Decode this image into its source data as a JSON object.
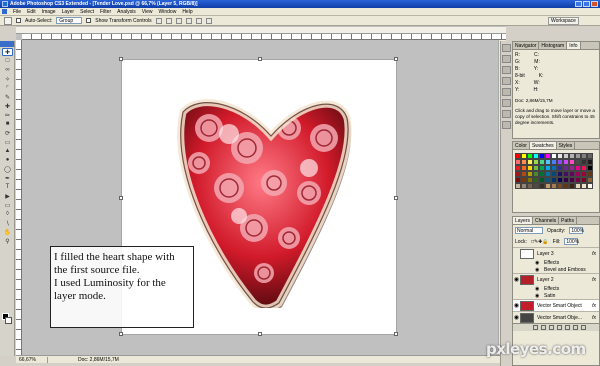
{
  "window": {
    "title": "Adobe Photoshop CS3 Extended - [Tender Love.psd @ 66,7% (Layer 5, RGB/8)]"
  },
  "menu": [
    "File",
    "Edit",
    "Image",
    "Layer",
    "Select",
    "Filter",
    "Analysis",
    "View",
    "Window",
    "Help"
  ],
  "options_bar": {
    "auto_select_label": "Auto-Select:",
    "auto_select_value": "Group",
    "show_transform_label": "Show Transform Controls",
    "workspace_label": "Workspace"
  },
  "status": {
    "zoom": "66,67%",
    "doc": "Doc: 2,86M/15,7M"
  },
  "navigator_panel": {
    "tabs": [
      "Navigator",
      "Histogram",
      "Info"
    ],
    "active_tab": "Info",
    "info_rows": [
      [
        "R:",
        "C:"
      ],
      [
        "G:",
        "M:"
      ],
      [
        "B:",
        "Y:"
      ],
      [
        "8-bit",
        "K:"
      ],
      [
        "X:",
        "W:"
      ],
      [
        "Y:",
        "H:"
      ]
    ],
    "doc_size": "Doc: 2,86M/15,7M",
    "message": "Click and drag to move layer or move a copy of selection. Shift constrains to 45 degree increments."
  },
  "swatches_panel": {
    "tabs": [
      "Color",
      "Swatches",
      "Styles"
    ],
    "active_tab": "Swatches",
    "colors": [
      "#ff0000",
      "#ffff00",
      "#00ff00",
      "#00ffff",
      "#0000ff",
      "#ff00ff",
      "#ffffff",
      "#e6e6e6",
      "#cccccc",
      "#b3b3b3",
      "#999999",
      "#808080",
      "#666666",
      "#ff6a6a",
      "#ff8c4a",
      "#fff15a",
      "#9bd84a",
      "#4ad88c",
      "#4ac8ff",
      "#4a7dff",
      "#8a4aff",
      "#c84aff",
      "#ff4ac2",
      "#4d4d4d",
      "#333333",
      "#1a1a1a",
      "#e41e26",
      "#f26522",
      "#ffd400",
      "#6fbe44",
      "#00a651",
      "#00aeef",
      "#0072bc",
      "#2e3192",
      "#662d91",
      "#92278f",
      "#ec008c",
      "#ed145b",
      "#000000",
      "#a3161b",
      "#b04a14",
      "#b8a000",
      "#4a8a2c",
      "#007236",
      "#0076a3",
      "#004a80",
      "#1b1464",
      "#440e62",
      "#630460",
      "#9e005d",
      "#9e0039",
      "#603913",
      "#7a0f12",
      "#7e350e",
      "#827200",
      "#326221",
      "#005826",
      "#005b7f",
      "#003663",
      "#0d004c",
      "#32004b",
      "#4b0049",
      "#7b0046",
      "#7a0026",
      "#8c6239",
      "#c7b299",
      "#998675",
      "#736357",
      "#534741",
      "#37302a",
      "#c69c6d",
      "#a67c52",
      "#754c24",
      "#603913",
      "#3c2415",
      "#e8d4b8",
      "#f0e0c8",
      "#fff8ec"
    ]
  },
  "layers_panel": {
    "tabs": [
      "Layers",
      "Channels",
      "Paths"
    ],
    "active_tab": "Layers",
    "blend_mode": "Normal",
    "opacity_label": "Opacity:",
    "opacity_value": "100%",
    "lock_label": "Lock:",
    "fill_label": "Fill:",
    "fill_value": "100%",
    "layers": [
      {
        "name": "Layer 3",
        "fx": "fx",
        "effects": [
          "Effects",
          "Bevel and Emboss"
        ]
      },
      {
        "name": "Layer 2",
        "fx": "fx",
        "effects": [
          "Effects",
          "Satin"
        ]
      },
      {
        "name": "Vector Smart Object",
        "fx": "fx",
        "effects": []
      },
      {
        "name": "Vector Smart Obje...",
        "fx": "fx",
        "effects": []
      }
    ]
  },
  "note": {
    "text": "I filled the heart shape with\nthe first source file.\nI used Luminosity for the\nlayer mode."
  },
  "watermark": "pxleyes.com"
}
